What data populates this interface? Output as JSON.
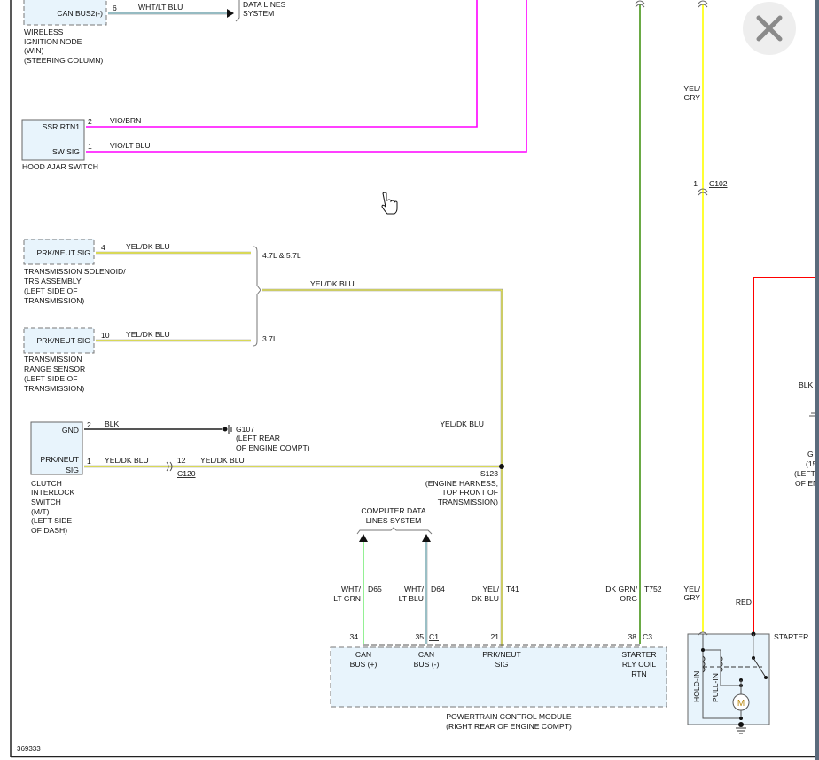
{
  "diagram_id": "369333",
  "colors": {
    "magenta": "#ff00ff",
    "yellow": "#ffff33",
    "green": "#6aaa45",
    "lt_green": "#88ee88",
    "lt_blue": "#a8e4ee",
    "red": "#ff0000",
    "gray": "#888888",
    "box_fill": "#e8f4fc"
  },
  "win": {
    "pin": "CAN BUS2(-)",
    "pin_no": "6",
    "wire": "WHT/LT BLU",
    "dest": [
      "DATA LINES",
      "SYSTEM"
    ],
    "label": [
      "WIRELESS",
      "IGNITION NODE",
      "(WIN)",
      "(STEERING COLUMN)"
    ]
  },
  "hood": {
    "pins": [
      {
        "name": "SSR RTN1",
        "no": "2",
        "wire": "VIO/BRN"
      },
      {
        "name": "SW SIG",
        "no": "1",
        "wire": "VIO/LT BLU"
      }
    ],
    "label": "HOOD AJAR SWITCH"
  },
  "trs": {
    "pin": "PRK/NEUT SIG",
    "pin_no": "4",
    "wire": "YEL/DK BLU",
    "label": [
      "TRANSMISSION SOLENOID/",
      "TRS ASSEMBLY",
      "(LEFT SIDE OF",
      "TRANSMISSION)"
    ],
    "engine": "4.7L & 5.7L"
  },
  "range": {
    "pin": "PRK/NEUT SIG",
    "pin_no": "10",
    "wire": "YEL/DK BLU",
    "label": [
      "TRANSMISSION",
      "RANGE SENSOR",
      "(LEFT SIDE OF",
      "TRANSMISSION)"
    ],
    "engine": "3.7L"
  },
  "merged_wire": "YEL/DK BLU",
  "clutch": {
    "gnd": "GND",
    "gnd_no": "2",
    "gnd_wire": "BLK",
    "ground": [
      "G107",
      "(LEFT REAR",
      "OF ENGINE COMPT)"
    ],
    "sig": [
      "PRK/NEUT",
      "SIG"
    ],
    "sig_no": "1",
    "sig_wire": "YEL/DK BLU",
    "conn_pin": "12",
    "conn": "C120",
    "conn_wire": "YEL/DK BLU",
    "label": [
      "CLUTCH",
      "INTERLOCK",
      "SWITCH",
      "(M/T)",
      "(LEFT SIDE",
      "OF DASH)"
    ]
  },
  "splice": {
    "wire": "YEL/DK BLU",
    "name": "S123",
    "label": [
      "(ENGINE HARNESS,",
      "TOP FRONT OF",
      "TRANSMISSION)"
    ]
  },
  "cdl": [
    "COMPUTER DATA",
    "LINES SYSTEM"
  ],
  "pcm_wires": [
    {
      "color": [
        "WHT/",
        "LT GRN"
      ],
      "circuit": "D65",
      "pin": "34",
      "conn": "",
      "func": [
        "CAN",
        "BUS (+)"
      ]
    },
    {
      "color": [
        "WHT/",
        "LT BLU"
      ],
      "circuit": "D64",
      "pin": "35",
      "conn": "C1",
      "func": [
        "CAN",
        "BUS (-)"
      ]
    },
    {
      "color": [
        "YEL/",
        "DK BLU"
      ],
      "circuit": "T41",
      "pin": "21",
      "conn": "",
      "func": [
        "PRK/NEUT",
        "SIG"
      ]
    },
    {
      "color": [
        "DK GRN/",
        "ORG"
      ],
      "circuit": "T752",
      "pin": "38",
      "conn": "C3",
      "func": [
        "STARTER",
        "RLY COIL",
        "RTN"
      ]
    }
  ],
  "pcm_label": [
    "POWERTRAIN CONTROL MODULE",
    "(RIGHT REAR OF ENGINE COMPT)"
  ],
  "starter": {
    "wire_top": [
      "YEL/",
      "GRY"
    ],
    "c102_pin": "1",
    "c102": "C102",
    "wire_bottom": [
      "YEL/",
      "GRY"
    ],
    "red": "RED",
    "label": "STARTER",
    "hold": "HOLD-IN",
    "pull": "PULL-IN",
    "motor": "M"
  },
  "right_partial": {
    "blk": "BLK",
    "g": "G",
    "l1": "(15",
    "l2": "(LEFT",
    "l3": "OF EN"
  }
}
